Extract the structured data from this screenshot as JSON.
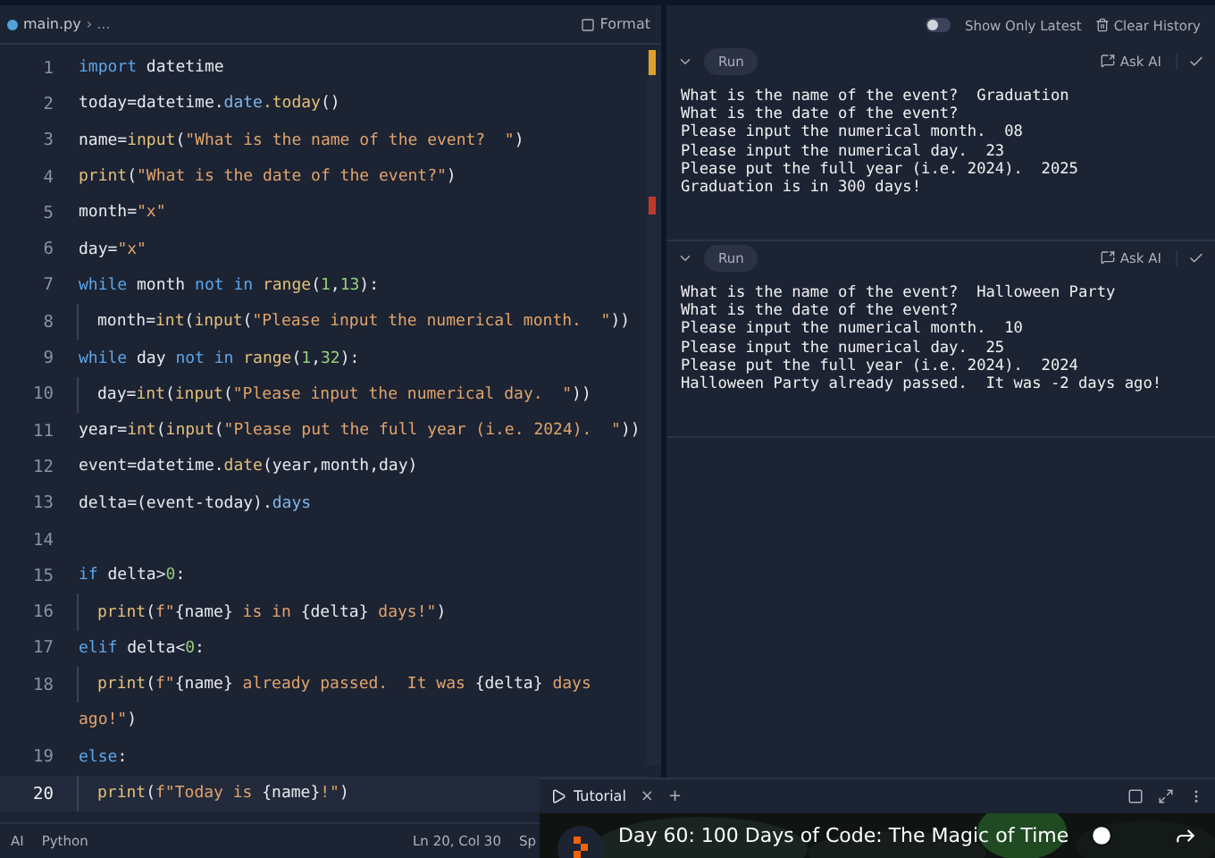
{
  "editor": {
    "breadcrumb": {
      "file": "main.py",
      "trail": "› ..."
    },
    "format_button": "Format",
    "lines": [
      {
        "number": "1",
        "current": false,
        "indented": false,
        "tokens": [
          {
            "kind": "kw",
            "text": "import"
          },
          {
            "kind": "plain",
            "text": " datetime"
          }
        ]
      },
      {
        "number": "2",
        "current": false,
        "indented": false,
        "tokens": [
          {
            "kind": "plain",
            "text": "today=datetime."
          },
          {
            "kind": "attr",
            "text": "date"
          },
          {
            "kind": "fn",
            "text": ".today"
          },
          {
            "kind": "plain",
            "text": "()"
          }
        ]
      },
      {
        "number": "3",
        "current": false,
        "indented": false,
        "tokens": [
          {
            "kind": "plain",
            "text": "name="
          },
          {
            "kind": "fn",
            "text": "input"
          },
          {
            "kind": "plain",
            "text": "("
          },
          {
            "kind": "str",
            "text": "\"What is the name of the event?  \""
          },
          {
            "kind": "plain",
            "text": ")"
          }
        ]
      },
      {
        "number": "4",
        "current": false,
        "indented": false,
        "tokens": [
          {
            "kind": "fn",
            "text": "print"
          },
          {
            "kind": "plain",
            "text": "("
          },
          {
            "kind": "str",
            "text": "\"What is the date of the event?\""
          },
          {
            "kind": "plain",
            "text": ")"
          }
        ]
      },
      {
        "number": "5",
        "current": false,
        "indented": false,
        "tokens": [
          {
            "kind": "plain",
            "text": "month="
          },
          {
            "kind": "str",
            "text": "\"x\""
          }
        ]
      },
      {
        "number": "6",
        "current": false,
        "indented": false,
        "tokens": [
          {
            "kind": "plain",
            "text": "day="
          },
          {
            "kind": "str",
            "text": "\"x\""
          }
        ]
      },
      {
        "number": "7",
        "current": false,
        "indented": false,
        "tokens": [
          {
            "kind": "kw",
            "text": "while"
          },
          {
            "kind": "plain",
            "text": " month "
          },
          {
            "kind": "kw",
            "text": "not in"
          },
          {
            "kind": "fn",
            "text": " range"
          },
          {
            "kind": "plain",
            "text": "("
          },
          {
            "kind": "num",
            "text": "1"
          },
          {
            "kind": "plain",
            "text": ","
          },
          {
            "kind": "num",
            "text": "13"
          },
          {
            "kind": "plain",
            "text": "):"
          }
        ]
      },
      {
        "number": "8",
        "current": false,
        "indented": true,
        "tokens": [
          {
            "kind": "plain",
            "text": "month="
          },
          {
            "kind": "fn",
            "text": "int"
          },
          {
            "kind": "plain",
            "text": "("
          },
          {
            "kind": "fn",
            "text": "input"
          },
          {
            "kind": "plain",
            "text": "("
          },
          {
            "kind": "str",
            "text": "\"Please input the numerical month.  \""
          },
          {
            "kind": "plain",
            "text": "))"
          }
        ]
      },
      {
        "number": "9",
        "current": false,
        "indented": false,
        "tokens": [
          {
            "kind": "kw",
            "text": "while"
          },
          {
            "kind": "plain",
            "text": " day "
          },
          {
            "kind": "kw",
            "text": "not in"
          },
          {
            "kind": "fn",
            "text": " range"
          },
          {
            "kind": "plain",
            "text": "("
          },
          {
            "kind": "num",
            "text": "1"
          },
          {
            "kind": "plain",
            "text": ","
          },
          {
            "kind": "num",
            "text": "32"
          },
          {
            "kind": "plain",
            "text": "):"
          }
        ]
      },
      {
        "number": "10",
        "current": false,
        "indented": true,
        "tokens": [
          {
            "kind": "plain",
            "text": "day="
          },
          {
            "kind": "fn",
            "text": "int"
          },
          {
            "kind": "plain",
            "text": "("
          },
          {
            "kind": "fn",
            "text": "input"
          },
          {
            "kind": "plain",
            "text": "("
          },
          {
            "kind": "str",
            "text": "\"Please input the numerical day.  \""
          },
          {
            "kind": "plain",
            "text": "))"
          }
        ]
      },
      {
        "number": "11",
        "current": false,
        "indented": false,
        "tokens": [
          {
            "kind": "plain",
            "text": "year="
          },
          {
            "kind": "fn",
            "text": "int"
          },
          {
            "kind": "plain",
            "text": "("
          },
          {
            "kind": "fn",
            "text": "input"
          },
          {
            "kind": "plain",
            "text": "("
          },
          {
            "kind": "str",
            "text": "\"Please put the full year (i.e. 2024).  \""
          },
          {
            "kind": "plain",
            "text": "))"
          }
        ]
      },
      {
        "number": "12",
        "current": false,
        "indented": false,
        "tokens": [
          {
            "kind": "plain",
            "text": "event=datetime."
          },
          {
            "kind": "fn",
            "text": "date"
          },
          {
            "kind": "plain",
            "text": "(year,month,day)"
          }
        ]
      },
      {
        "number": "13",
        "current": false,
        "indented": false,
        "tokens": [
          {
            "kind": "plain",
            "text": "delta=(event-today)."
          },
          {
            "kind": "attr",
            "text": "days"
          }
        ]
      },
      {
        "number": "14",
        "current": false
      },
      {
        "number": "15",
        "current": false,
        "indented": false,
        "tokens": [
          {
            "kind": "kw",
            "text": "if"
          },
          {
            "kind": "plain",
            "text": " delta>"
          },
          {
            "kind": "num",
            "text": "0"
          },
          {
            "kind": "plain",
            "text": ":"
          }
        ]
      },
      {
        "number": "16",
        "current": false,
        "indented": true,
        "tokens": [
          {
            "kind": "fn",
            "text": "print"
          },
          {
            "kind": "plain",
            "text": "("
          },
          {
            "kind": "str",
            "text": "f\""
          },
          {
            "kind": "plain",
            "text": "{name}"
          },
          {
            "kind": "str",
            "text": " is in "
          },
          {
            "kind": "plain",
            "text": "{delta}"
          },
          {
            "kind": "str",
            "text": " days!\""
          },
          {
            "kind": "plain",
            "text": ")"
          }
        ]
      },
      {
        "number": "17",
        "current": false,
        "indented": false,
        "tokens": [
          {
            "kind": "kw",
            "text": "elif"
          },
          {
            "kind": "plain",
            "text": " delta<"
          },
          {
            "kind": "num",
            "text": "0"
          },
          {
            "kind": "plain",
            "text": ":"
          }
        ]
      },
      {
        "number": "18",
        "current": false,
        "indented": true,
        "tokens": [
          {
            "kind": "fn",
            "text": "print"
          },
          {
            "kind": "plain",
            "text": "("
          },
          {
            "kind": "str",
            "text": "f\""
          },
          {
            "kind": "plain",
            "text": "{name}"
          },
          {
            "kind": "str",
            "text": " already passed.  It was "
          },
          {
            "kind": "plain",
            "text": "{delta}"
          },
          {
            "kind": "str",
            "text": " days"
          }
        ],
        "wrap": [
          {
            "kind": "str",
            "text": "ago!\""
          },
          {
            "kind": "plain",
            "text": ")"
          }
        ]
      },
      {
        "number": "19",
        "current": false,
        "indented": false,
        "tokens": [
          {
            "kind": "kw",
            "text": "else"
          },
          {
            "kind": "plain",
            "text": ":"
          }
        ]
      },
      {
        "number": "20",
        "current": true,
        "indented": true,
        "tokens": [
          {
            "kind": "fn",
            "text": "print"
          },
          {
            "kind": "plain",
            "text": "("
          },
          {
            "kind": "str",
            "text": "f\"Today is "
          },
          {
            "kind": "plain",
            "text": "{name}"
          },
          {
            "kind": "str",
            "text": "!\""
          },
          {
            "kind": "plain",
            "text": ")"
          }
        ]
      }
    ]
  },
  "status_bar": {
    "ai": "AI",
    "language": "Python",
    "position": "Ln 20, Col 30",
    "spaces": "Sp"
  },
  "console": {
    "show_only_latest": {
      "label": "Show Only Latest",
      "on": false
    },
    "clear_history": "Clear History",
    "runs": [
      {
        "run_label": "Run",
        "ask_ai": "Ask AI",
        "output": [
          "What is the name of the event?  Graduation",
          "What is the date of the event?",
          "Please input the numerical month.  08",
          "Please input the numerical day.  23",
          "Please put the full year (i.e. 2024).  2025",
          "Graduation is in 300 days!"
        ]
      },
      {
        "run_label": "Run",
        "ask_ai": "Ask AI",
        "output": [
          "What is the name of the event?  Halloween Party",
          "What is the date of the event?",
          "Please input the numerical month.  10",
          "Please input the numerical day.  25",
          "Please put the full year (i.e. 2024).  2024",
          "Halloween Party already passed.  It was -2 days ago!"
        ]
      }
    ]
  },
  "tutorial": {
    "tab": "Tutorial",
    "close": "×",
    "add": "+",
    "video_title": "Day 60: 100 Days of Code: The Magic of Time"
  }
}
